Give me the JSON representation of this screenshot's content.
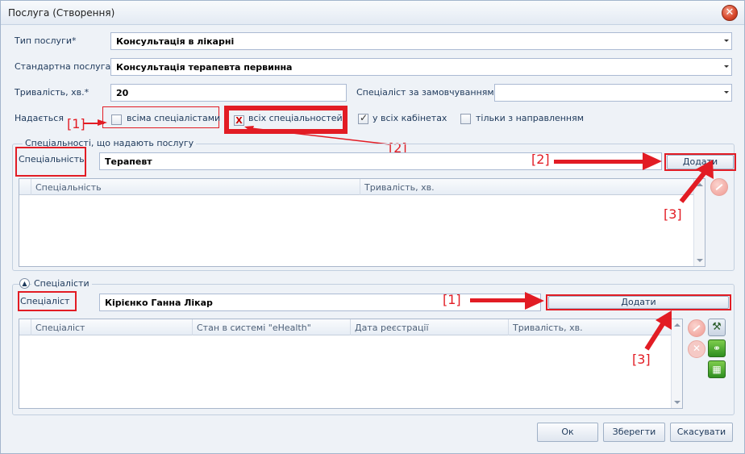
{
  "window": {
    "title": "Послуга (Створення)",
    "close_glyph": "✕"
  },
  "form": {
    "service_type_label": "Тип послуги*",
    "service_type_value": "Консультація в лікарні",
    "standard_service_label": "Стандартна послуга",
    "standard_service_value": "Консультація терапевта первинна",
    "duration_label": "Тривалість, хв.*",
    "duration_value": "20",
    "default_specialist_label": "Спеціаліст за замовчуванням",
    "default_specialist_value": "",
    "provided_label": "Надається",
    "checkboxes": {
      "all_specialists": {
        "label": "всіма спеціалістами",
        "checked": false
      },
      "all_specialties": {
        "label": "всіх спеціальностей",
        "checked": false,
        "mark": "X"
      },
      "all_cabinets": {
        "label": "у всіх кабінетах",
        "checked": true
      },
      "referral_only": {
        "label": "тільки з направленням",
        "checked": false
      }
    }
  },
  "specialties_group": {
    "title": "Спеціальності, що надають послугу",
    "field_label": "Спеціальність",
    "field_value": "Терапевт",
    "add_button": "Додати",
    "columns": [
      "Спеціальність",
      "Тривалість, хв."
    ]
  },
  "specialists_group": {
    "title": "Спеціалісти",
    "field_label": "Спеціаліст",
    "field_value": "Кірієнко Ганна Лікар",
    "add_button": "Додати",
    "columns": [
      "Спеціаліст",
      "Стан в системі \"eHealth\"",
      "Дата реєстрації",
      "Тривалість, хв."
    ]
  },
  "annotations": {
    "a1": "[1]",
    "a2": "[2]",
    "a3": "[3]",
    "b1": "[1]",
    "b2": "[2]",
    "b3": "[3]"
  },
  "icons": {
    "edit_glyph": "⚒",
    "link_glyph": "⚭",
    "grid_glyph": "▦",
    "remove_glyph": "✕"
  },
  "footer": {
    "ok": "Ок",
    "save": "Зберегти",
    "cancel": "Скасувати"
  },
  "colors": {
    "annotation_red": "#e21c24",
    "label_blue": "#1e395b"
  }
}
